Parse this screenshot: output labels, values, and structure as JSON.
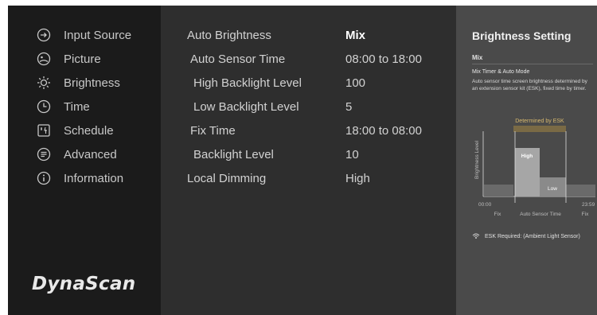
{
  "sidebar": {
    "items": [
      {
        "label": "Input Source",
        "icon": "input-source-icon"
      },
      {
        "label": "Picture",
        "icon": "picture-icon"
      },
      {
        "label": "Brightness",
        "icon": "brightness-icon"
      },
      {
        "label": "Time",
        "icon": "clock-icon"
      },
      {
        "label": "Schedule",
        "icon": "schedule-icon"
      },
      {
        "label": "Advanced",
        "icon": "advanced-icon"
      },
      {
        "label": "Information",
        "icon": "info-icon"
      }
    ],
    "selected": "Brightness",
    "logo": "DynaScan"
  },
  "settings": {
    "rows": [
      {
        "label": "Auto Brightness",
        "value": "Mix"
      },
      {
        "label": "Auto Sensor Time",
        "value": "08:00 to 18:00"
      },
      {
        "label": "High Backlight Level",
        "value": "100"
      },
      {
        "label": "Low Backlight Level",
        "value": "5"
      },
      {
        "label": "Fix Time",
        "value": "18:00 to 08:00"
      },
      {
        "label": "Backlight Level",
        "value": "10"
      },
      {
        "label": "Local Dimming",
        "value": "High"
      }
    ]
  },
  "panel": {
    "title": "Brightness Setting",
    "subtitle": "Mix",
    "heading": "Mix Timer & Auto Mode",
    "description": "Auto sensor time screen brightness determined by an extension sensor kit (ESK), fixed time by timer.",
    "chart": {
      "determined_label": "Determined by ESK",
      "y_label": "Brightness Level",
      "high_label": "High",
      "low_label": "Low",
      "start_time": "00:00",
      "end_time": "23:59",
      "fix_label_left": "Fix",
      "middle_label": "Auto Sensor Time",
      "fix_label_right": "Fix"
    },
    "esk_note": "ESK Required: (Ambient Light Sensor)"
  },
  "colors": {
    "screen_bg": "#222222",
    "sidebar_bg": "#1b1b1b",
    "main_bg": "#2e2e2e",
    "panel_bg": "#4a4a4a",
    "esk_accent": "#c9b07a"
  }
}
